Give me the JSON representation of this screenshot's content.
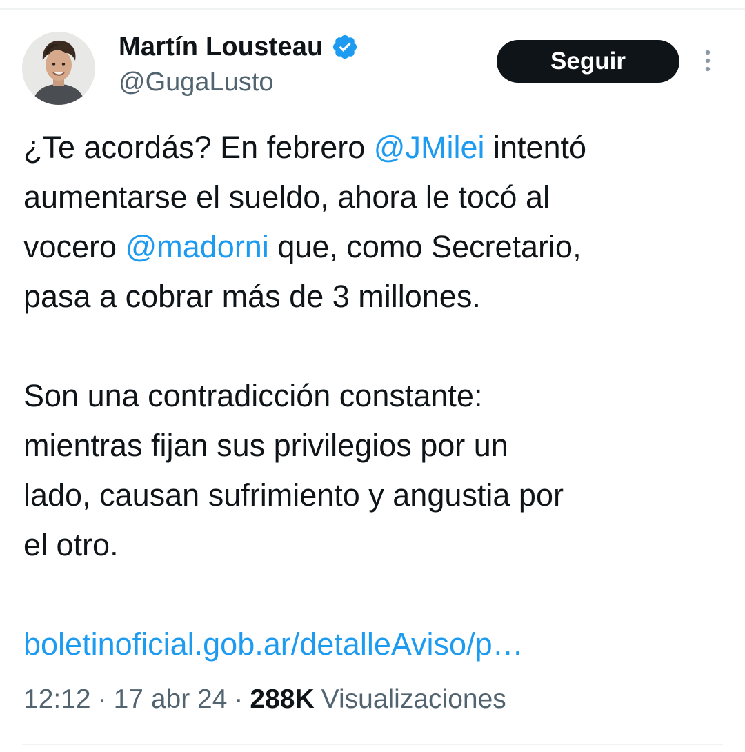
{
  "tweet": {
    "author": {
      "display_name": "Martín Lousteau",
      "handle": "@GugaLusto",
      "verified": true,
      "avatar": "profile-photo"
    },
    "follow_button_label": "Seguir",
    "more_icon": "vertical-ellipsis-icon",
    "body": {
      "line1_pre": "¿Te acordás? En febrero ",
      "line1_mention": "@JMilei",
      "line1_post": " intentó",
      "line2": "aumentarse el sueldo, ahora le tocó al",
      "line3_pre": "vocero ",
      "line3_mention": "@madorni",
      "line3_post": " que, como Secretario,",
      "line4": "pasa a cobrar más de 3 millones.",
      "line5": "Son una contradicción constante:",
      "line6": "mientras fijan sus privilegios por un",
      "line7": "lado, causan sufrimiento y angustia por",
      "line8": "el otro.",
      "link": "boletinoficial.gob.ar/detalleAviso/p…"
    },
    "meta": {
      "time": "12:12",
      "separator": "·",
      "date": "17 abr 24",
      "views_count": "288K",
      "views_label": "Visualizaciones"
    }
  },
  "colors": {
    "text": "#0f1419",
    "secondary_text": "#536471",
    "link": "#1d9bf0",
    "button_bg": "#0f1419",
    "button_text": "#ffffff",
    "verified_badge": "#1d9bf0"
  }
}
